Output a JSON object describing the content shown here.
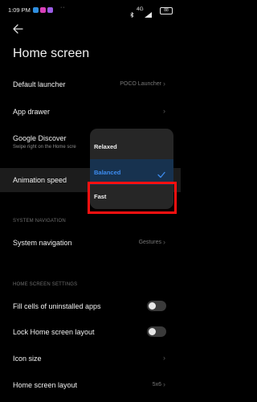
{
  "status_bar": {
    "time": "1:09 PM",
    "dots": "··",
    "network": "4G",
    "battery": "88"
  },
  "header": {
    "back_icon": "back-arrow-icon",
    "title": "Home screen"
  },
  "settings": {
    "default_launcher": {
      "title": "Default launcher",
      "value": "POCO Launcher"
    },
    "app_drawer": {
      "title": "App drawer"
    },
    "google_discover": {
      "title": "Google Discover",
      "subtitle": "Swipe right on the Home scre"
    },
    "animation_speed": {
      "title": "Animation speed"
    }
  },
  "system_navigation_section": {
    "header": "SYSTEM NAVIGATION",
    "system_navigation": {
      "title": "System navigation",
      "value": "Gestures"
    }
  },
  "home_screen_settings_section": {
    "header": "HOME SCREEN SETTINGS",
    "fill_cells": {
      "title": "Fill cells of uninstalled apps",
      "enabled": false
    },
    "lock_layout": {
      "title": "Lock Home screen layout",
      "enabled": false
    },
    "icon_size": {
      "title": "Icon size"
    },
    "home_layout": {
      "title": "Home screen layout",
      "value": "5x6"
    }
  },
  "animation_speed_menu": {
    "options": [
      "Relaxed",
      "Balanced",
      "Fast"
    ],
    "selected": "Balanced",
    "highlighted": "Fast"
  },
  "colors": {
    "background": "#000000",
    "selected_text": "#3d8cf0",
    "highlight_box": "#ff1010"
  },
  "chevron": "›"
}
